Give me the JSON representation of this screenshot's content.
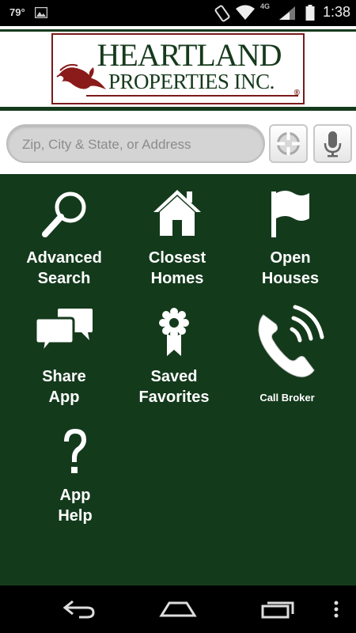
{
  "status_bar": {
    "temperature": "79°",
    "network": "4G",
    "time": "1:38",
    "icons": [
      "image-icon",
      "screen-rotation-icon",
      "wifi-icon",
      "signal-icon",
      "battery-icon"
    ]
  },
  "header": {
    "logo_line1": "HEARTLAND",
    "logo_line2": "PROPERTIES INC.",
    "logo_registered": "®"
  },
  "search": {
    "placeholder": "Zip, City & State, or Address"
  },
  "menu": {
    "advanced_search": {
      "line1": "Advanced",
      "line2": "Search",
      "icon": "magnifier-icon"
    },
    "closest_homes": {
      "line1": "Closest",
      "line2": "Homes",
      "icon": "house-icon"
    },
    "open_houses": {
      "line1": "Open",
      "line2": "Houses",
      "icon": "flag-icon"
    },
    "share_app": {
      "line1": "Share",
      "line2": "App",
      "icon": "speech-bubbles-icon"
    },
    "saved_favorites": {
      "line1": "Saved",
      "line2": "Favorites",
      "icon": "ribbon-award-icon"
    },
    "call_broker": {
      "label": "Call Broker",
      "icon": "phone-icon"
    },
    "app_help": {
      "line1": "App",
      "line2": "Help",
      "icon": "question-mark-icon"
    }
  },
  "colors": {
    "brand_green": "#143a1c",
    "brand_red": "#7a1a1a"
  },
  "nav_bar": {
    "icons": [
      "back-icon",
      "home-icon",
      "recents-icon",
      "overflow-menu-icon"
    ]
  }
}
